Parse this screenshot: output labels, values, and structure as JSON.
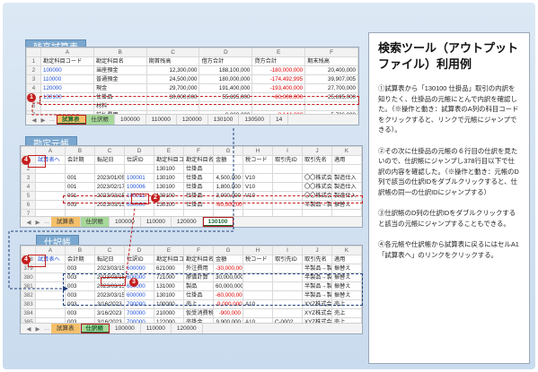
{
  "trial": {
    "title": "残高試算表",
    "cols": [
      "",
      "A",
      "B",
      "C",
      "D",
      "E",
      "F"
    ],
    "headers": [
      "勘定科目コード",
      "勘定科目名",
      "期首残高",
      "借方合計",
      "貸方合計",
      "期末残高"
    ],
    "rows": [
      [
        "100000",
        "当座預金",
        "12,300,000",
        "188,100,000",
        "-180,000,000",
        "20,400,000"
      ],
      [
        "110000",
        "普通預金",
        "24,500,000",
        "180,000,000",
        "-174,492,995",
        "39,907,005"
      ],
      [
        "120000",
        "現金",
        "29,700,000",
        "191,400,000",
        "-193,400,000",
        "27,700,000"
      ],
      [
        "130100",
        "仕掛品",
        "30,000,000",
        "55,695,000",
        "-60,000,000",
        "25,695,000"
      ],
      [
        "",
        "材料",
        "",
        "",
        "",
        ""
      ],
      [
        "",
        "前払費用",
        "",
        "8,880,000",
        "-3,144,000",
        "5,736,000"
      ]
    ],
    "rownums": [
      "1",
      "2",
      "3",
      "4",
      "5",
      "6",
      "7"
    ],
    "tabs": [
      "試算表",
      "仕訳帳",
      "100000",
      "110000",
      "120000",
      "130100",
      "130500",
      "14"
    ]
  },
  "ledger": {
    "title": "勘定元帳",
    "cols": [
      "",
      "A",
      "B",
      "C",
      "D",
      "E",
      "F",
      "G",
      "H",
      "I",
      "J",
      "K"
    ],
    "headers": [
      "試算表へ",
      "会計期",
      "転記日",
      "仕訳ID",
      "勘定科目コード",
      "勘定科目名",
      "金額",
      "税コード",
      "取引先ID",
      "取引先名",
      "適用"
    ],
    "rows": [
      [
        "",
        "",
        "",
        "",
        "130100",
        "仕掛品",
        "",
        "",
        "",
        "",
        ""
      ],
      [
        "",
        "001",
        "2023/01/05",
        "100001",
        "130100",
        "仕掛品",
        "4,500,000",
        "V10",
        "",
        "〇〇株式会社",
        "製造仕入"
      ],
      [
        "",
        "001",
        "2023/02/17",
        "100006",
        "130100",
        "仕掛品",
        "1,800,000",
        "V10",
        "",
        "〇〇株式会社",
        "製造仕入"
      ],
      [
        "",
        "001",
        "2023/03/15",
        "100011",
        "130100",
        "仕掛品",
        "3,000,000",
        "V10",
        "",
        "〇〇株式会社",
        "製造仕入"
      ],
      [
        "",
        "003",
        "2023/03/15",
        "600000",
        "130100",
        "仕掛品",
        "-60,000,000",
        "",
        "",
        "半製品→製品",
        "振替え"
      ],
      [
        "",
        "",
        "",
        "",
        "",
        "",
        "",
        "",
        "",
        "",
        ""
      ]
    ],
    "rownums": [
      "1",
      "2",
      "3",
      "4",
      "5",
      "6",
      "7"
    ],
    "tabs": [
      "試算表",
      "仕訳帳",
      "100000",
      "110000",
      "120000",
      "130100"
    ]
  },
  "journal": {
    "title": "仕訳帳",
    "cols": [
      "",
      "A",
      "B",
      "C",
      "D",
      "E",
      "F",
      "G",
      "H",
      "I",
      "J",
      "K"
    ],
    "headers": [
      "試算表へ",
      "会計期",
      "転記日",
      "仕訳ID",
      "勘定科目コード",
      "勘定科目名",
      "金額",
      "税コード",
      "取引先ID",
      "取引先名",
      "適用"
    ],
    "rows": [
      [
        "",
        "003",
        "2023/03/15",
        "600000",
        "621000",
        "外注費用",
        "-30,000,000",
        "",
        "",
        "半製品→製品",
        "振替え"
      ],
      [
        "",
        "003",
        "2023/03/15",
        "600000",
        "721000",
        "原価計算",
        "30,000,000",
        "",
        "",
        "半製品→製品",
        "振替え"
      ],
      [
        "",
        "003",
        "2023/03/15",
        "600000",
        "131000",
        "製品",
        "60,000,000",
        "",
        "",
        "半製品→製品",
        "振替え"
      ],
      [
        "",
        "003",
        "2023/03/15",
        "600000",
        "130100",
        "仕掛品",
        "-60,000,000",
        "",
        "",
        "半製品→製品",
        "振替え"
      ],
      [
        "",
        "003",
        "3/16/2023",
        "700000",
        "100000",
        "売上",
        "-9,000,000",
        "A10",
        "",
        "XYZ株式会社",
        "売上"
      ],
      [
        "",
        "003",
        "3/16/2023",
        "700000",
        "210000",
        "仮受消費税",
        "-900,000",
        "",
        "",
        "XYZ株式会社",
        "売上"
      ],
      [
        "",
        "003",
        "3/16/2023",
        "700000",
        "122000",
        "売掛金",
        "9,900,000",
        "A10",
        "C-0002",
        "XYZ株式会社",
        "売上"
      ]
    ],
    "rownums": [
      "378",
      "379",
      "380",
      "381",
      "382",
      "383",
      "384",
      "385"
    ],
    "tabs": [
      "試算表",
      "仕訳帳",
      "100000",
      "110000",
      "120000"
    ]
  },
  "info": {
    "title": "検索ツール（アウトプットファイル）利用例",
    "p1": "①試算表から「130100 仕掛品」取引の内訳を知りたく、仕掛品の元帳にとんで内訳を確認した。（※操作と動き：試算表のA列の科目コードをクリックすると、リンクで元帳にジャンプできる）。",
    "p2": "②その次に仕掛品の元帳の６行目の仕訳を見たいので、仕訳帳にジャンプし378行目以下で仕訳の内容を確認した。（※操作と動き：元帳のD列で該当の仕訳IDをダブルクリックすると、仕訳帳の同一の仕訳IDにジャンプする）",
    "p3": "③仕訳帳のD列の仕訳IDをダブルクリックすると該当の元帳にジャンプすることもできる。",
    "p4": "④各元帳や仕訳帳から試算表に戻るにはセルA1「試算表へ」のリンクをクリックする。"
  },
  "badges": [
    "1",
    "2",
    "3",
    "4",
    "4"
  ]
}
